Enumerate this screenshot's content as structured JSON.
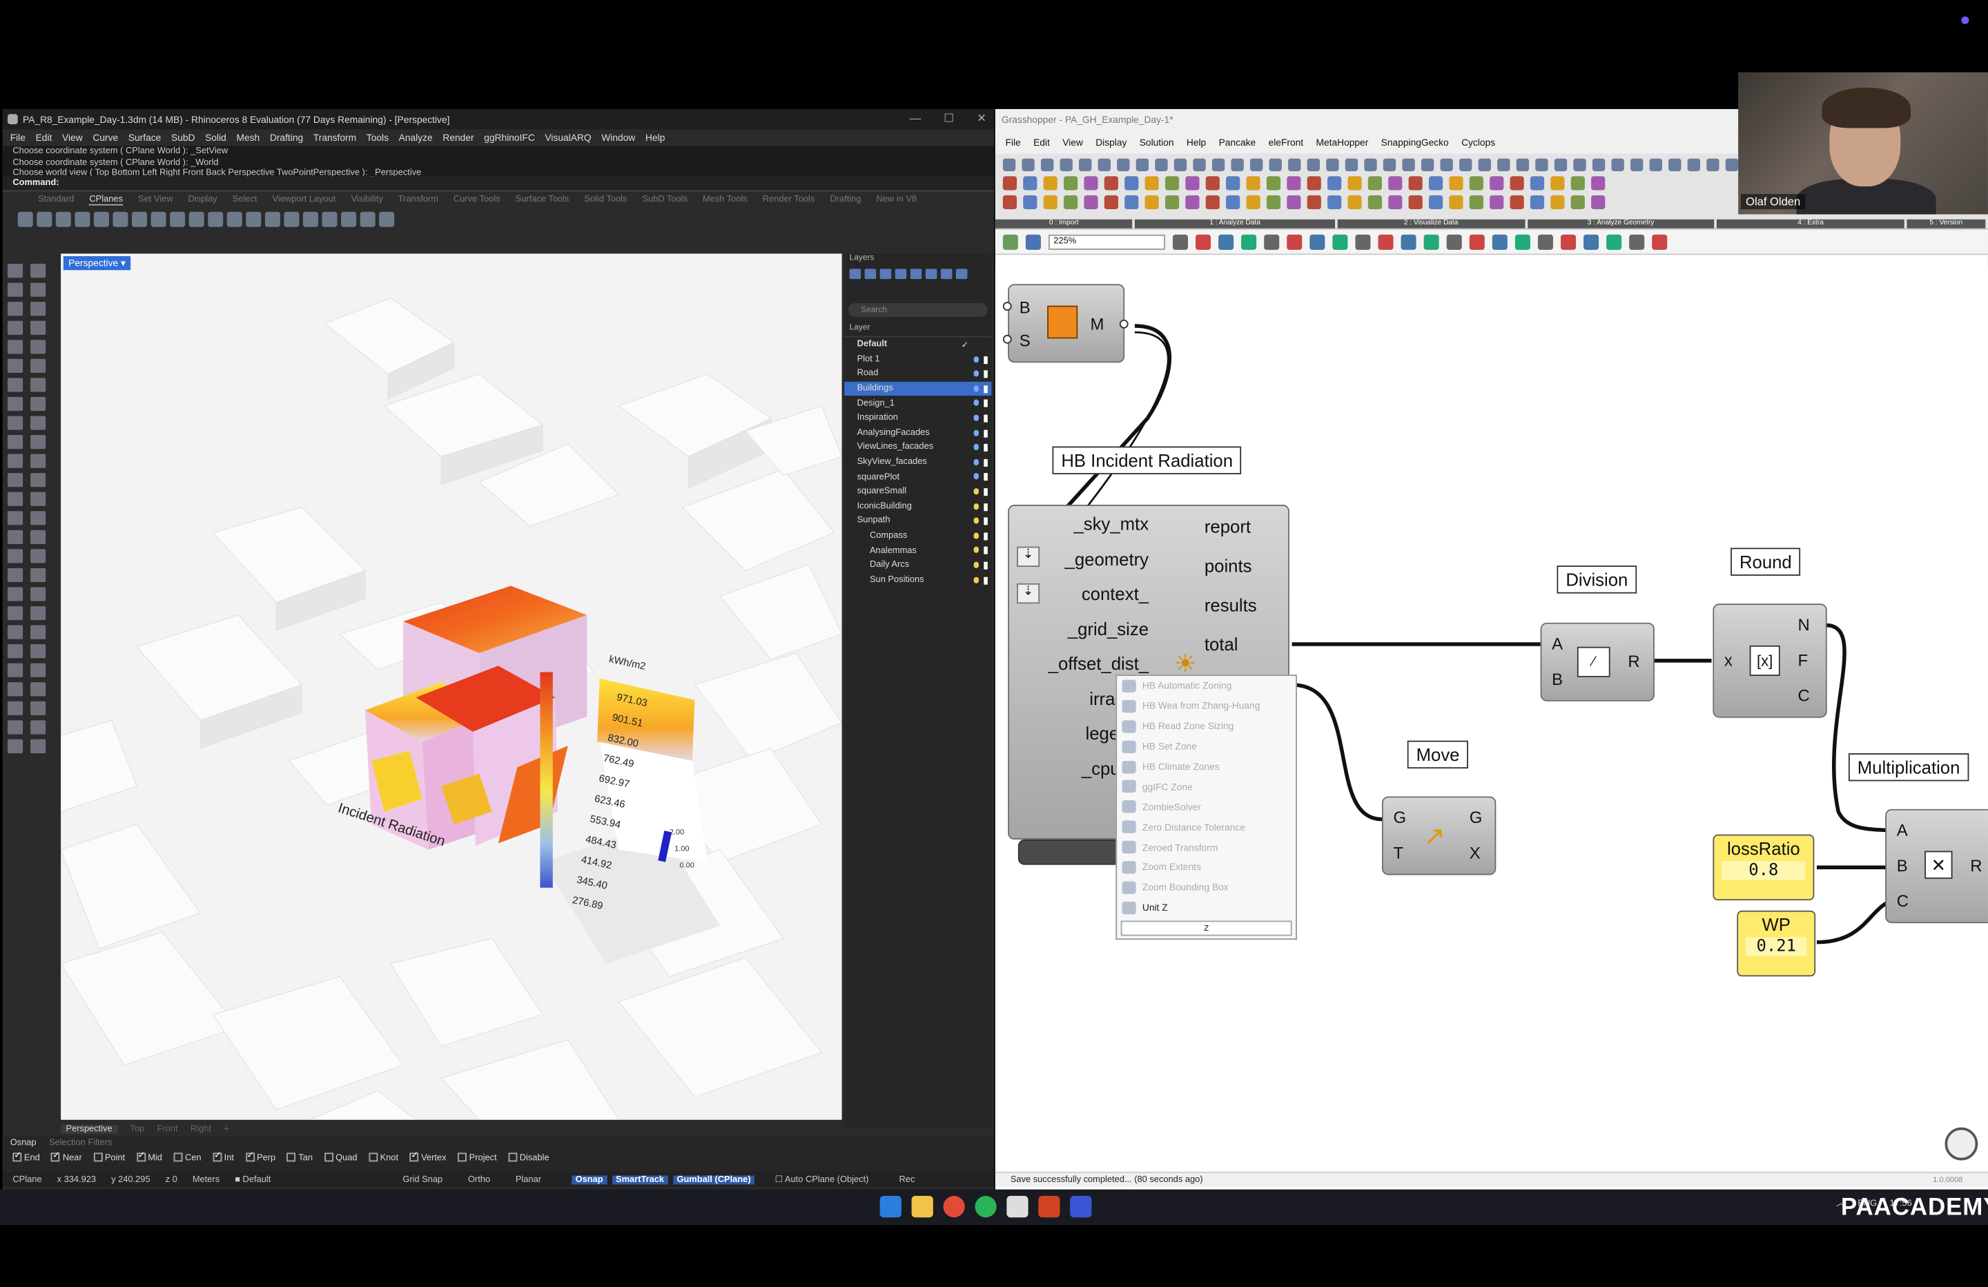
{
  "rhino": {
    "title": "PA_R8_Example_Day-1.3dm (14 MB) - Rhinoceros 8 Evaluation (77 Days Remaining) - [Perspective]",
    "menu": [
      "File",
      "Edit",
      "View",
      "Curve",
      "Surface",
      "SubD",
      "Solid",
      "Mesh",
      "Drafting",
      "Transform",
      "Tools",
      "Analyze",
      "Render",
      "ggRhinoIFC",
      "VisualARQ",
      "Window",
      "Help"
    ],
    "command_history": [
      "Choose coordinate system ( CPlane World ): _SetView",
      "Choose coordinate system ( CPlane World ): _World",
      "Choose world view ( Top Bottom Left Right Front Back Perspective TwoPointPerspective ): _Perspective"
    ],
    "command_label": "Command:",
    "toolbar_tabs": [
      "Standard",
      "CPlanes",
      "Set View",
      "Display",
      "Select",
      "Viewport Layout",
      "Visibility",
      "Transform",
      "Curve Tools",
      "Surface Tools",
      "Solid Tools",
      "SubD Tools",
      "Mesh Tools",
      "Render Tools",
      "Drafting",
      "New in V8"
    ],
    "active_toolbar_tab": "CPlanes",
    "viewport_label": "Perspective",
    "viewport_tabs": [
      "Perspective",
      "Top",
      "Front",
      "Right",
      "+"
    ],
    "viewport_annotation": "Incident Radiation",
    "legend_title": "kWh/m2",
    "legend_values": [
      "971.03",
      "901.51",
      "832.00",
      "762.49",
      "692.97",
      "623.46",
      "553.94",
      "484.43",
      "414.92",
      "345.40",
      "276.89"
    ],
    "legend2_values": [
      "0.00",
      "1.00",
      "2.00"
    ],
    "layers": {
      "panel_title": "Layers",
      "search_placeholder": "Search",
      "column": "Layer",
      "items": [
        {
          "name": "Default",
          "style": "bold"
        },
        {
          "name": "Plot 1",
          "style": ""
        },
        {
          "name": "Road",
          "style": ""
        },
        {
          "name": "Buildings",
          "style": "sel"
        },
        {
          "name": "Design_1",
          "style": ""
        },
        {
          "name": "Inspiration",
          "style": ""
        },
        {
          "name": "AnalysingFacades",
          "style": ""
        },
        {
          "name": "ViewLines_facades",
          "style": ""
        },
        {
          "name": "SkyView_facades",
          "style": ""
        },
        {
          "name": "squarePlot",
          "style": ""
        },
        {
          "name": "squareSmall",
          "style": ""
        },
        {
          "name": "IconicBuilding",
          "style": ""
        },
        {
          "name": "Sunpath",
          "style": ""
        },
        {
          "name": "Compass",
          "style": "sub"
        },
        {
          "name": "Analemmas",
          "style": "sub"
        },
        {
          "name": "Daily Arcs",
          "style": "sub"
        },
        {
          "name": "Sun Positions",
          "style": "sub"
        }
      ]
    },
    "osnap": {
      "tabs": [
        "Osnap",
        "Selection Filters"
      ],
      "options": [
        {
          "label": "End",
          "on": true
        },
        {
          "label": "Near",
          "on": true
        },
        {
          "label": "Point",
          "on": false
        },
        {
          "label": "Mid",
          "on": true
        },
        {
          "label": "Cen",
          "on": false
        },
        {
          "label": "Int",
          "on": true
        },
        {
          "label": "Perp",
          "on": true
        },
        {
          "label": "Tan",
          "on": false
        },
        {
          "label": "Quad",
          "on": false
        },
        {
          "label": "Knot",
          "on": false
        },
        {
          "label": "Vertex",
          "on": true
        },
        {
          "label": "Project",
          "on": false
        },
        {
          "label": "Disable",
          "on": false
        }
      ]
    },
    "status": {
      "cplane": "CPlane",
      "x": "x 334.923",
      "y": "y 240.295",
      "z": "z 0",
      "units": "Meters",
      "layer": "Default",
      "toggles": [
        "Grid Snap",
        "Ortho",
        "Planar"
      ],
      "pills": [
        "Osnap",
        "SmartTrack",
        "Gumball (CPlane)"
      ],
      "auto_cplane": "Auto CPlane (Object)",
      "rec": "Rec"
    }
  },
  "grasshopper": {
    "title": "Grasshopper - PA_GH_Example_Day-1*",
    "menu": [
      "File",
      "Edit",
      "View",
      "Display",
      "Solution",
      "Help",
      "Pancake",
      "eleFront",
      "MetaHopper",
      "SnappingGecko",
      "Cyclops"
    ],
    "ribbon_groups": [
      "0 : Import",
      "1 : Analyze Data",
      "2 : Visualize Data",
      "3 : Analyze Geometry",
      "4 : Extra",
      "5 : Version"
    ],
    "zoom": "225%",
    "nodes": {
      "mesh": {
        "inputs": [
          "B",
          "S"
        ],
        "outputs": [
          "M"
        ]
      },
      "incident": {
        "title": "HB Incident Radiation",
        "inputs": [
          "_sky_mtx",
          "_geometry",
          "context_",
          "_grid_size",
          "_offset_dist_",
          "irradian",
          "legend_",
          "_cpu_co"
        ],
        "outputs": [
          "report",
          "points",
          "results",
          "total"
        ]
      },
      "division": {
        "title": "Division",
        "inputs": [
          "A",
          "B"
        ],
        "outputs": [
          "R"
        ]
      },
      "round": {
        "title": "Round",
        "inputs": [
          "x"
        ],
        "outputs": [
          "N",
          "F",
          "C"
        ]
      },
      "move": {
        "title": "Move",
        "inputs": [
          "G",
          "T"
        ],
        "outputs": [
          "G",
          "X"
        ]
      },
      "multiplication": {
        "title": "Multiplication",
        "inputs": [
          "A",
          "B",
          "C"
        ],
        "outputs": [
          "R"
        ]
      },
      "lossRatio": {
        "title": "lossRatio",
        "value": "0.8"
      },
      "wp": {
        "title": "WP",
        "value": "0.21"
      }
    },
    "context_menu": [
      "HB Automatic Zoning",
      "HB Wea from Zhang-Huang",
      "HB Read Zone Sizing",
      "HB Set Zone",
      "HB Climate Zones",
      "ggIFC Zone",
      "ZombieSolver",
      "Zero Distance Tolerance",
      "Zeroed Transform",
      "Zoom Extents",
      "Zoom Bounding Box",
      "Unit Z"
    ],
    "search_value": "z",
    "status": "Save successfully completed... (80 seconds ago)",
    "version": "1.0.0008"
  },
  "webcam": {
    "name": "Olaf Olden"
  },
  "taskbar": {
    "lang": "ENG",
    "time": "17:56"
  },
  "brand": "PAACADEMY"
}
